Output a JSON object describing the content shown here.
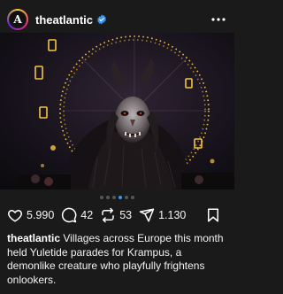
{
  "post": {
    "username": "theatlantic",
    "avatar_letter": "A",
    "verified": true
  },
  "icons": {
    "verified": "verified-badge-icon",
    "more": "more-options-icon",
    "like": "heart-icon",
    "comment": "comment-icon",
    "repost": "repost-icon",
    "share": "send-icon",
    "save": "bookmark-icon"
  },
  "carousel": {
    "total": 6,
    "active": 3
  },
  "actions": {
    "likes": "5.990",
    "comments": "42",
    "reposts": "53",
    "shares": "1.130"
  },
  "caption": {
    "username": "theatlantic",
    "text": " Villages across Europe this month held Yuletide parades for Krampus, a demonlike creature who playfully frightens onlookers."
  },
  "colors": {
    "background": "#1a1a1a",
    "verified": "#3897f0",
    "ferris_wheel_lights": "#f5c542"
  }
}
